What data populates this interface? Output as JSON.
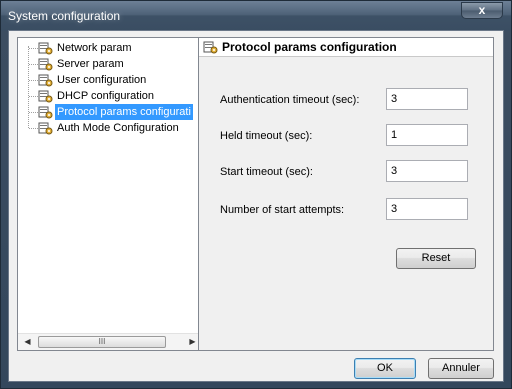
{
  "window": {
    "title": "System configuration",
    "close_glyph": "x"
  },
  "tree": {
    "items": [
      {
        "label": "Network param",
        "icon": "config-icon",
        "selected": false
      },
      {
        "label": "Server param",
        "icon": "config-icon",
        "selected": false
      },
      {
        "label": "User configuration",
        "icon": "config-icon",
        "selected": false
      },
      {
        "label": "DHCP configuration",
        "icon": "config-icon",
        "selected": false
      },
      {
        "label": "Protocol params configurati",
        "icon": "config-icon",
        "selected": true
      },
      {
        "label": "Auth Mode Configuration",
        "icon": "config-icon",
        "selected": false
      }
    ],
    "scroll_left": "◀",
    "scroll_right": "▶",
    "scroll_grip": "III"
  },
  "panel": {
    "title": "Protocol params configuration",
    "fields": [
      {
        "label": "Authentication timeout (sec):",
        "value": "3"
      },
      {
        "label": "Held timeout (sec):",
        "value": "1"
      },
      {
        "label": "Start timeout (sec):",
        "value": "3"
      },
      {
        "label": "Number of start attempts:",
        "value": "3"
      }
    ],
    "reset_label": "Reset"
  },
  "footer": {
    "ok_label": "OK",
    "cancel_label": "Annuler"
  },
  "colors": {
    "selection": "#3399ff",
    "titlebar": "#4e6278"
  }
}
